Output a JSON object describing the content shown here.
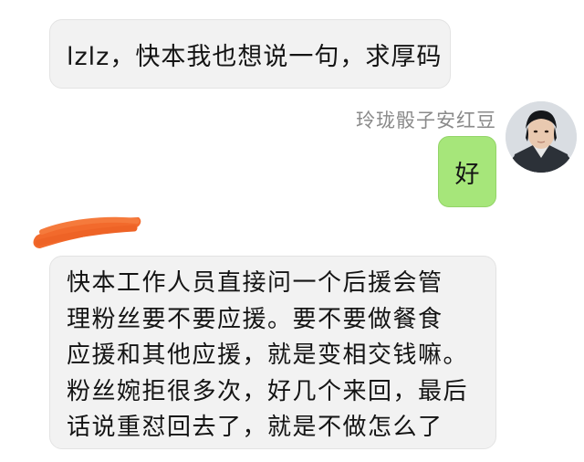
{
  "messages": [
    {
      "side": "left",
      "text": "lzlz，快本我也想说一句，求厚码"
    },
    {
      "side": "right",
      "sender": "玲珑骰子安红豆",
      "text": "好"
    },
    {
      "side": "left",
      "lines": [
        "快本工作人员直接问一个后援会管",
        "理粉丝要不要应援。要不要做餐食",
        "应援和其他应援，就是变相交钱嘛。",
        "粉丝婉拒很多次，好几个来回，最后",
        "话说重怼回去了，就是不做怎么了"
      ]
    }
  ],
  "colors": {
    "received_bubble": "#f2f2f2",
    "sent_bubble": "#a6e67a",
    "redaction": "#f26a2c",
    "sender_name": "#8a8a8a"
  }
}
